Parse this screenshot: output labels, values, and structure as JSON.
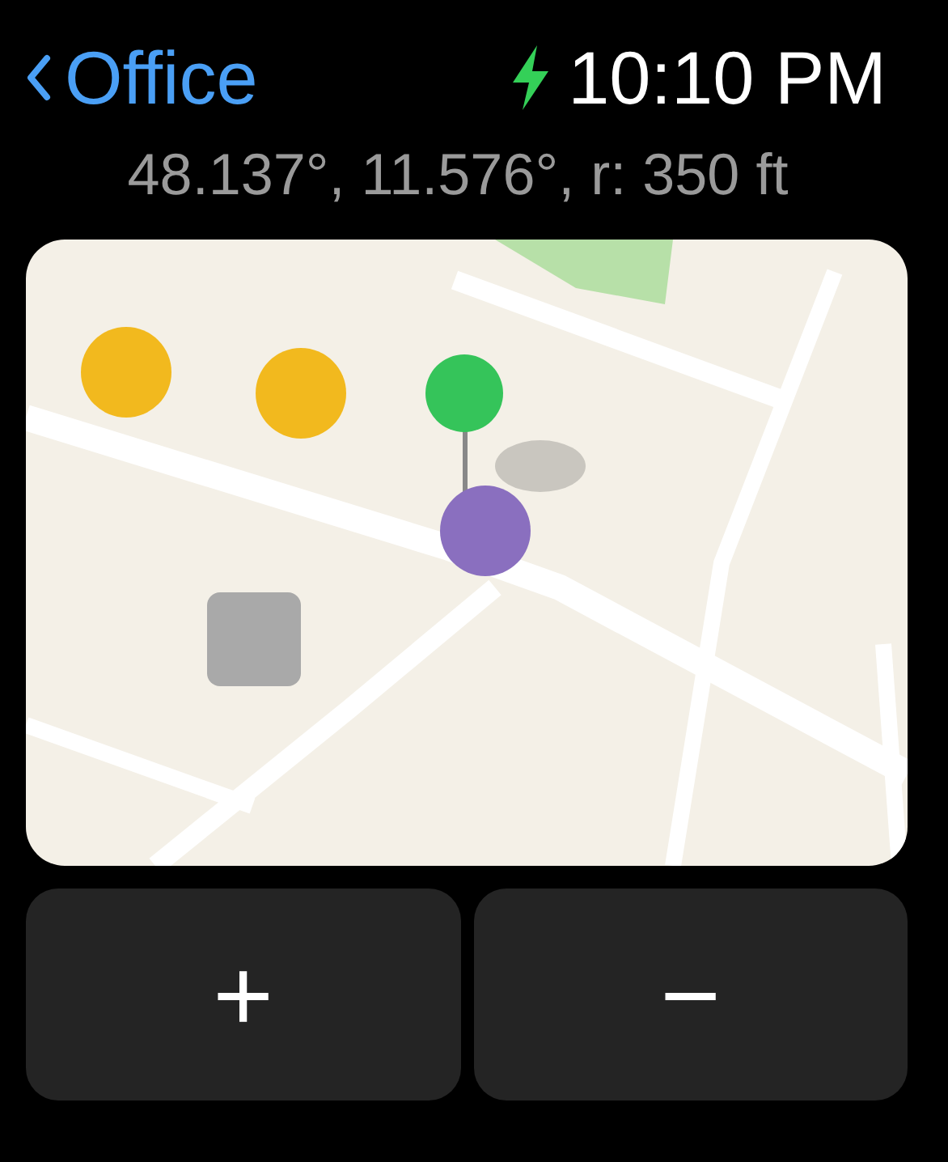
{
  "header": {
    "back_label": "Office",
    "charging": true,
    "time": "10:10 PM"
  },
  "coordinates": "48.137°, 11.576°, r: 350 ft",
  "buttons": [
    {
      "label": "+"
    },
    {
      "label": "−"
    }
  ]
}
